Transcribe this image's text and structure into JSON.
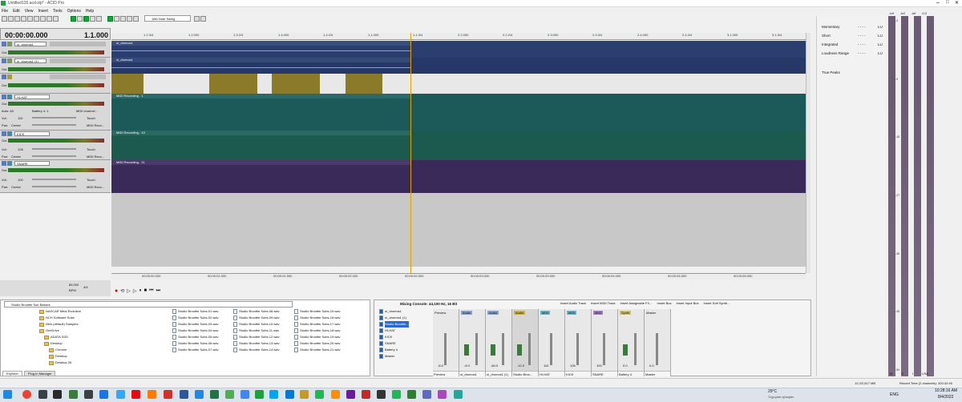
{
  "window": {
    "title": "Untitled126.acd-zip* - ACID Pro"
  },
  "menu": [
    "File",
    "Edit",
    "View",
    "Insert",
    "Tools",
    "Options",
    "Help"
  ],
  "toolbar": {
    "note_length": "16th Note Swing"
  },
  "transport": {
    "time": "00:00:00.000",
    "measure": "1.1.000",
    "bpm_a": "85.000",
    "bpm_b": "BPM",
    "sig": "4/4"
  },
  "ruler": [
    "1.2.3/4",
    "1.2.000",
    "1.3.2/4",
    "1.4.000",
    "1.4.2/4",
    "1.1.000",
    "1.1.3/4",
    "2.2.000",
    "2.2.2/4",
    "2.3.000",
    "2.3.3/4",
    "2.4.000",
    "2.4.3/4",
    "3.1.000",
    "3.1.3/4"
  ],
  "bottom_ruler": [
    "00:00:00.000",
    "00:00:01.000",
    "00:00:01.500",
    "00:00:02.000",
    "00:00:02.500",
    "00:00:03.000",
    "00:00:03.500",
    "00:00:04.000",
    "00:00:04.500",
    "00:00:05.000",
    "00:00:05.500"
  ],
  "tracks": [
    {
      "name": "oi_dromos1",
      "out": "Out",
      "clip": "oi_dromos1"
    },
    {
      "name": "oi_dromos1 (1)",
      "out": "Out",
      "clip": "oi_dromos1"
    },
    {
      "name": "Studio Broottie...",
      "out": "Out",
      "clip": ""
    },
    {
      "name": "HI-HAT",
      "out": "Out",
      "auto": "Auto: All",
      "battery": "Battery 4: 1",
      "midi": "MIDI channel...",
      "vol": "Vol:",
      "vol_val": "110",
      "pan": "Pan:",
      "pan_val": "Center",
      "touch": "Touch",
      "midi_rec": "MIDI Reco...",
      "clip": "MIDI Recording - 1"
    },
    {
      "name": "KICK",
      "out": "Out",
      "vol": "Vol:",
      "vol_val": "126",
      "pan": "Pan:",
      "pan_val": "Center",
      "touch": "Touch",
      "midi_rec": "MIDI Reco...",
      "clip": "MIDI Recording - 10"
    },
    {
      "name": "SNARE",
      "out": "Out",
      "vol": "Vol:",
      "vol_val": "100",
      "pan": "Pan:",
      "pan_val": "Center",
      "touch": "Touch",
      "midi_rec": "MIDI Reco...",
      "clip": "MIDI Recording - 11"
    }
  ],
  "explorer": {
    "path": "Studio Broottie Sub Basses",
    "tree": [
      "NASCAR Meal Evolution",
      "NCH Software Suite",
      "New (default) Samples",
      "OneDrive",
      "ADATA SSD",
      "Desktop",
      "Chrome",
      "Desktop",
      "Desktop 26"
    ],
    "files_col1": [
      "Studio Broottie Subs-01.wav",
      "Studio Broottie Subs-02.wav",
      "Studio Broottie Subs-03.wav",
      "Studio Broottie Subs-04.wav",
      "Studio Broottie Subs-05.wav",
      "Studio Broottie Subs-06.wav",
      "Studio Broottie Subs-07.wav"
    ],
    "files_col2": [
      "Studio Broottie Subs-08.wav",
      "Studio Broottie Subs-09.wav",
      "Studio Broottie Subs-10.wav",
      "Studio Broottie Subs-11.wav",
      "Studio Broottie Subs-12.wav",
      "Studio Broottie Subs-13.wav",
      "Studio Broottie Subs-14.wav"
    ],
    "files_col3": [
      "Studio Broottie Subs-15.wav",
      "Studio Broottie Subs-16.wav",
      "Studio Broottie Subs-17.wav",
      "Studio Broottie Subs-18.wav",
      "Studio Broottie Subs-19.wav",
      "Studio Broottie Subs-20.wav",
      "Studio Broottie Subs-21.wav"
    ],
    "tabs": [
      "Explorer",
      "Plug-In Manager"
    ]
  },
  "mixer": {
    "title": "Mixing Console: 44,100 Hz, 16 Bit",
    "list": [
      "oi_dromos1",
      "oi_dromos1 (1)",
      "Studio Broottie...",
      "HI-HAT",
      "KICK",
      "SNARE",
      "Battery 4",
      "Master"
    ],
    "buttons": [
      "Insert Audio Track",
      "Insert MIDI Track",
      "Insert Assignable FX...",
      "Insert Bus",
      "Insert Input Bus",
      "Insert Soft Synth..."
    ],
    "strips": [
      {
        "head": "Preview",
        "name": "Preview",
        "val": "-6.0"
      },
      {
        "head": "Audio",
        "name": "oi_dromos1",
        "val": "-6.0"
      },
      {
        "head": "Audio",
        "name": "oi_dromos1 (1)",
        "val": "-60.0"
      },
      {
        "head": "Audio",
        "name": "Studio Broo...",
        "val": "-12.0"
      },
      {
        "head": "MIDI",
        "name": "HI-HAT",
        "val": "110"
      },
      {
        "head": "MIDI",
        "name": "KICK",
        "val": "126"
      },
      {
        "head": "MIDI",
        "name": "SNARE",
        "val": "100"
      },
      {
        "head": "Synth",
        "name": "Battery 4",
        "val": "0.0"
      },
      {
        "head": "Master",
        "name": "Master",
        "val": "0.0"
      }
    ]
  },
  "loudness": {
    "rows": [
      {
        "label": "Momentary",
        "val": "- - - -",
        "unit": "LU"
      },
      {
        "label": "Short",
        "val": "- - - -",
        "unit": "LU"
      },
      {
        "label": "Integrated",
        "val": "- - - -",
        "unit": "LU"
      },
      {
        "label": "Loudness Range",
        "val": "- - - -",
        "unit": "LU"
      }
    ],
    "true_peaks": "True Peaks"
  },
  "meters": {
    "scale": [
      "-3",
      "-6",
      "-9",
      "-12",
      "-15",
      "-18",
      "-21",
      "-24",
      "-27",
      "-30",
      "-33",
      "-36",
      "-39",
      "-42",
      "-45",
      "-48",
      "-51",
      "-54"
    ],
    "bottom": [
      "M",
      "S",
      "I",
      "LRA"
    ],
    "top": [
      "-Inf",
      "-Inf",
      "-Inf",
      "0.0"
    ]
  },
  "status": {
    "disk": "12,/22,617 MB",
    "record": "Record Time (2 channels): 320:42:45"
  },
  "taskbar": {
    "temp": "29°C",
    "weather": "Ξεχωριστ.ηλιοφάν.",
    "lang": "ENG",
    "clock": "10:28:16 AM",
    "date": "8/4/2022"
  }
}
